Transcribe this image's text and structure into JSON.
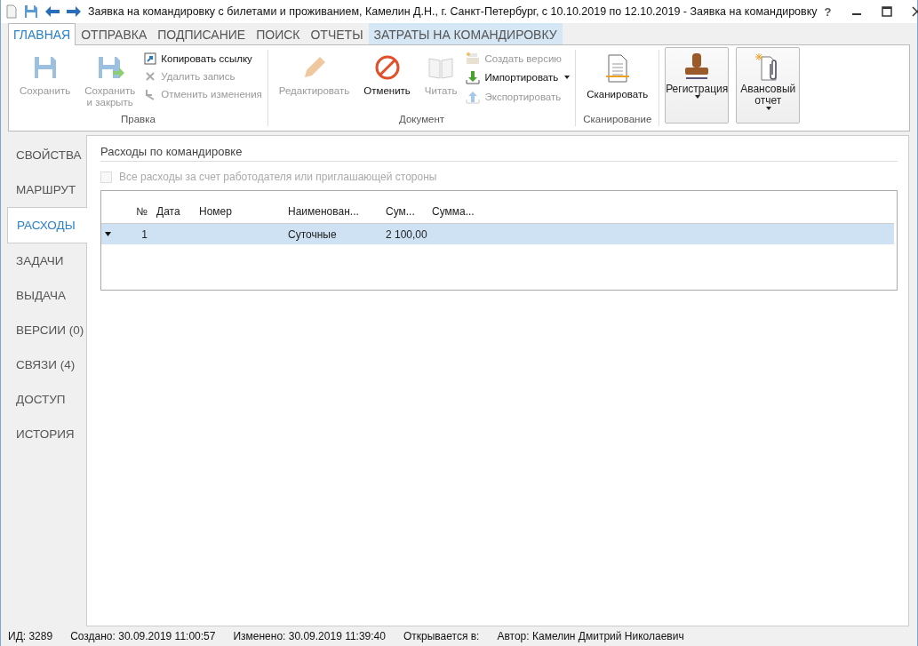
{
  "window": {
    "title": "Заявка на командировку с билетами и проживанием, Камелин Д.Н., г. Санкт-Петербург, с 10.10.2019 по 12.10.2019 - Заявка на командировку",
    "help": "?"
  },
  "ribbon_tabs": [
    {
      "label": "ГЛАВНАЯ",
      "selected": true,
      "kind": "normal"
    },
    {
      "label": "ОТПРАВКА",
      "selected": false,
      "kind": "normal"
    },
    {
      "label": "ПОДПИСАНИЕ",
      "selected": false,
      "kind": "normal"
    },
    {
      "label": "ПОИСК",
      "selected": false,
      "kind": "normal"
    },
    {
      "label": "ОТЧЕТЫ",
      "selected": false,
      "kind": "normal"
    },
    {
      "label": "ЗАТРАТЫ НА КОМАНДИРОВКУ",
      "selected": false,
      "kind": "contextual"
    }
  ],
  "ribbon_groups": [
    {
      "label": "Правка",
      "items": [
        {
          "kind": "large",
          "label": "Сохранить",
          "disabled": true,
          "dropdown": false
        },
        {
          "kind": "large",
          "label": "Сохранить\nи закрыть",
          "disabled": true,
          "dropdown": false
        },
        {
          "kind": "small",
          "label": "Копировать ссылку",
          "disabled": false,
          "dropdown": false
        },
        {
          "kind": "small",
          "label": "Удалить запись",
          "disabled": true,
          "dropdown": false
        },
        {
          "kind": "small",
          "label": "Отменить изменения",
          "disabled": true,
          "dropdown": false
        }
      ]
    },
    {
      "label": "Документ",
      "items": [
        {
          "kind": "large",
          "label": "Редактировать",
          "disabled": true,
          "dropdown": false
        },
        {
          "kind": "large",
          "label": "Отменить",
          "disabled": false,
          "dropdown": false
        },
        {
          "kind": "large",
          "label": "Читать",
          "disabled": true,
          "dropdown": false
        },
        {
          "kind": "small",
          "label": "Создать версию",
          "disabled": true,
          "dropdown": false
        },
        {
          "kind": "small",
          "label": "Импортировать",
          "disabled": false,
          "dropdown": true
        },
        {
          "kind": "small",
          "label": "Экспортировать",
          "disabled": true,
          "dropdown": false
        }
      ]
    },
    {
      "label": "Сканирование",
      "items": [
        {
          "kind": "large",
          "label": "Сканировать",
          "disabled": false,
          "dropdown": false
        }
      ]
    },
    {
      "items": [
        {
          "kind": "framed",
          "label": "Регистрация",
          "disabled": false,
          "dropdown": true
        },
        {
          "kind": "framed",
          "label": "Авансовый\nотчет",
          "disabled": false,
          "dropdown": true
        }
      ]
    }
  ],
  "sidebar": {
    "items": [
      {
        "label": "СВОЙСТВА",
        "selected": false
      },
      {
        "label": "МАРШРУТ",
        "selected": false
      },
      {
        "label": "РАСХОДЫ",
        "selected": true
      },
      {
        "label": "ЗАДАЧИ",
        "selected": false
      },
      {
        "label": "ВЫДАЧА",
        "selected": false
      },
      {
        "label": "ВЕРСИИ (0)",
        "selected": false
      },
      {
        "label": "СВЯЗИ (4)",
        "selected": false
      },
      {
        "label": "ДОСТУП",
        "selected": false
      },
      {
        "label": "ИСТОРИЯ",
        "selected": false
      }
    ]
  },
  "section": {
    "title": "Расходы по командировке",
    "checkbox": {
      "label": "Все расходы за счет работодателя или приглашающей стороны",
      "checked": false,
      "disabled": true
    },
    "table": {
      "columns": [
        "№",
        "Дата",
        "Номер",
        "Наименован...",
        "Сум...",
        "Сумма..."
      ],
      "rows": [
        {
          "selected": true,
          "cells": [
            "1",
            "",
            "",
            "Суточные",
            "2 100,00",
            ""
          ]
        }
      ]
    }
  },
  "status_bar": [
    "ИД: 3289",
    "Создано: 30.09.2019 11:00:57",
    "Изменено: 30.09.2019 11:39:40",
    "Открывается в:",
    "Автор: Камелин Дмитрий Николаевич"
  ]
}
